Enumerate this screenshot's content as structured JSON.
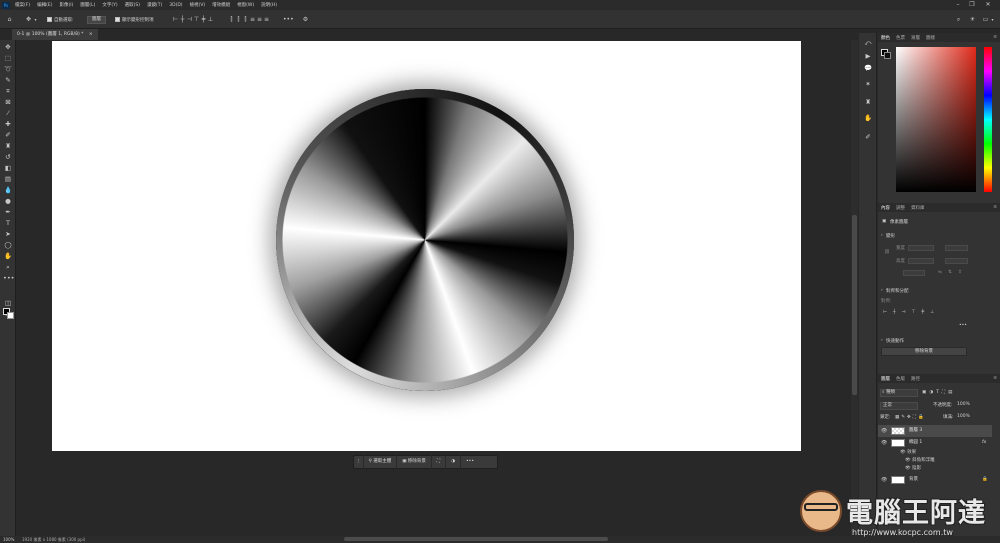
{
  "menubar": {
    "app_icon": "Ps",
    "items": [
      "檔案(F)",
      "編輯(E)",
      "影像(I)",
      "圖層(L)",
      "文字(Y)",
      "選取(S)",
      "濾鏡(T)",
      "3D(D)",
      "檢視(V)",
      "增效模組",
      "視窗(W)",
      "說明(H)"
    ]
  },
  "options": {
    "auto_select_label": "自動選取:",
    "auto_select_target": "圖層",
    "transform_controls_label": "顯示變形控制項",
    "more_icon": "ellipsis-icon"
  },
  "document": {
    "tab_title": "0-1 @ 100% (圖層 1, RGB/8) *"
  },
  "context_bar": {
    "select_subject": "選取主體",
    "remove_background": "移除背景"
  },
  "status": {
    "zoom": "100%",
    "size": "1920 像素 x 1080 像素 (300 ppi)"
  },
  "panels": {
    "color_tabs": [
      "顏色",
      "色票",
      "漸層",
      "圖樣"
    ],
    "properties_tabs": [
      "內容",
      "調整",
      "資料庫"
    ],
    "pixel_layer": "像素圖層",
    "transform_heading": "變形",
    "w_label": "寬度",
    "h_label": "高度",
    "align_heading": "對齊和分配",
    "align_label": "對齊:",
    "quick_actions_heading": "快速動作",
    "remove_bg_button": "移除背景",
    "layers_tabs": [
      "圖層",
      "色版",
      "路徑"
    ],
    "kind_filter": "種類",
    "blend_mode": "正常",
    "opacity_label": "不透明度:",
    "opacity_value": "100%",
    "lock_label": "鎖定:",
    "fill_label": "填滿:",
    "fill_value": "100%"
  },
  "layers": [
    {
      "name": "圖層 3",
      "visible": true,
      "selected": true
    },
    {
      "name": "橢圓 1",
      "visible": true,
      "selected": false,
      "fx": "fx"
    },
    {
      "name": "背景",
      "visible": true,
      "selected": false
    }
  ],
  "effects": {
    "effects_label": "效果",
    "bevel": "斜角和浮雕",
    "shadow": "陰影"
  },
  "watermark": {
    "text": "電腦王阿達",
    "url": "http://www.kocpc.com.tw"
  },
  "colors": {
    "foreground": "#000000",
    "background": "#ffffff",
    "ui_dark": "#282828",
    "panel": "#333333"
  }
}
